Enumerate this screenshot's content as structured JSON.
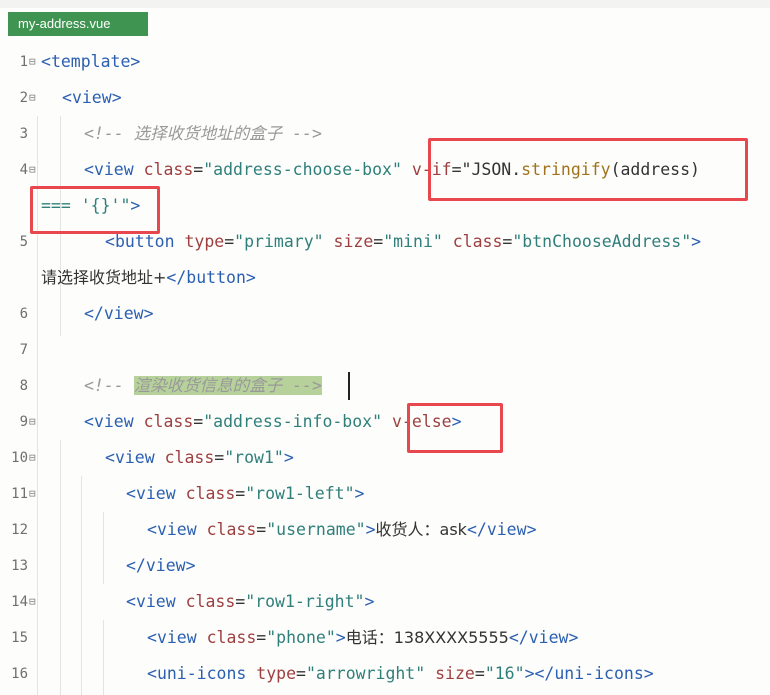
{
  "tab": {
    "filename": "my-address.vue"
  },
  "lines": [
    {
      "num": "1",
      "parts": [
        "<",
        "template",
        ">"
      ]
    },
    {
      "num": "2",
      "parts": [
        "<",
        "view",
        ">"
      ]
    },
    {
      "num": "3",
      "parts": [
        "<!-- 选择收货地址的盒子 -->"
      ]
    },
    {
      "num": "4",
      "parts": [
        "<",
        "view",
        "class",
        "=",
        "\"address-choose-box\"",
        "v-if",
        "=",
        "\"JSON",
        ".",
        "stringify",
        "(address)"
      ]
    },
    {
      "num": "",
      "parts": [
        "=== '{}'\"",
        ">"
      ]
    },
    {
      "num": "5",
      "parts": [
        "<",
        "button",
        "type",
        "=",
        "\"primary\"",
        "size",
        "=",
        "\"mini\"",
        "class",
        "=",
        "\"btnChooseAddress\"",
        ">"
      ]
    },
    {
      "num": "",
      "parts": [
        "请选择收货地址+",
        "</",
        "button",
        ">"
      ]
    },
    {
      "num": "6",
      "parts": [
        "</",
        "view",
        ">"
      ]
    },
    {
      "num": "7",
      "parts": []
    },
    {
      "num": "8",
      "parts": [
        "<!-- ",
        "渲染收货信息的盒子 -->"
      ]
    },
    {
      "num": "9",
      "parts": [
        "<",
        "view",
        "class",
        "=",
        "\"address-info-box\"",
        "v-else",
        ">"
      ]
    },
    {
      "num": "10",
      "parts": [
        "<",
        "view",
        "class",
        "=",
        "\"row1\"",
        ">"
      ]
    },
    {
      "num": "11",
      "parts": [
        "<",
        "view",
        "class",
        "=",
        "\"row1-left\"",
        ">"
      ]
    },
    {
      "num": "12",
      "parts": [
        "<",
        "view",
        "class",
        "=",
        "\"username\"",
        ">",
        "收货人：ask",
        "</",
        "view",
        ">"
      ]
    },
    {
      "num": "13",
      "parts": [
        "</",
        "view",
        ">"
      ]
    },
    {
      "num": "14",
      "parts": [
        "<",
        "view",
        "class",
        "=",
        "\"row1-right\"",
        ">"
      ]
    },
    {
      "num": "15",
      "parts": [
        "<",
        "view",
        "class",
        "=",
        "\"phone\"",
        ">",
        "电话：138XXXX5555",
        "</",
        "view",
        ">"
      ]
    },
    {
      "num": "16",
      "parts": [
        "<",
        "uni-icons",
        "type",
        "=",
        "\"arrowright\"",
        "size",
        "=",
        "\"16\"",
        "></",
        "uni-icons",
        ">"
      ]
    }
  ]
}
